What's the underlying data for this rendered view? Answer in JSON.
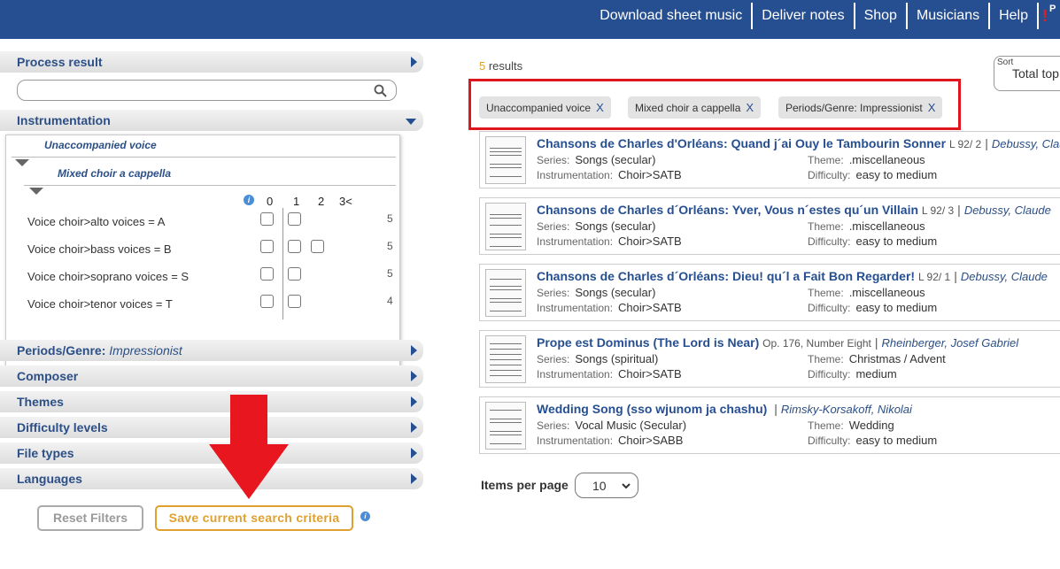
{
  "topnav": {
    "items": [
      "Download sheet music",
      "Deliver notes",
      "Shop",
      "Musicians",
      "Help"
    ],
    "logo_fragment": "P"
  },
  "sidebar": {
    "process_result": "Process result",
    "search_placeholder": "",
    "instrumentation": {
      "label": "Instrumentation",
      "chain": [
        "Unaccompanied voice",
        "Mixed choir a cappella"
      ],
      "column_headers": [
        "0",
        "1",
        "2",
        "3<"
      ],
      "rows": [
        {
          "label": "Voice choir>alto voices = A",
          "count": "5"
        },
        {
          "label": "Voice choir>bass voices = B",
          "count": "5"
        },
        {
          "label": "Voice choir>soprano voices = S",
          "count": "5"
        },
        {
          "label": "Voice choir>tenor voices = T",
          "count": "4"
        }
      ]
    },
    "periods_label": "Periods/Genre:",
    "periods_value": "Impressionist",
    "sections": [
      "Composer",
      "Themes",
      "Difficulty levels",
      "File types",
      "Languages"
    ],
    "reset_label": "Reset Filters",
    "save_label": "Save current search criteria"
  },
  "results": {
    "count": "5",
    "count_suffix": " results",
    "sort_label": "Sort",
    "sort_value": "Total top",
    "active_filters": [
      "Unaccompanied voice",
      "Mixed choir a cappella",
      "Periods/Genre: Impressionist"
    ],
    "filter_remove": "X",
    "labels": {
      "series": "Series:",
      "instrumentation": "Instrumentation:",
      "theme": "Theme:",
      "difficulty": "Difficulty:"
    },
    "items": [
      {
        "title": "Chansons de Charles d'Orléans: Quand j´ai Ouy le Tambourin Sonner",
        "opus": "L 92/ 2",
        "composer": "Debussy, Claude",
        "series": "Songs (secular)",
        "instrumentation": "Choir>SATB",
        "theme": ".miscellaneous",
        "difficulty": "easy to medium"
      },
      {
        "title": "Chansons de Charles d´Orléans: Yver, Vous n´estes qu´un Villain",
        "opus": "L 92/ 3",
        "composer": "Debussy, Claude",
        "series": "Songs (secular)",
        "instrumentation": "Choir>SATB",
        "theme": ".miscellaneous",
        "difficulty": "easy to medium"
      },
      {
        "title": "Chansons de Charles d´Orléans: Dieu! qu´l a Fait Bon Regarder!",
        "opus": "L 92/ 1",
        "composer": "Debussy, Claude",
        "series": "Songs (secular)",
        "instrumentation": "Choir>SATB",
        "theme": ".miscellaneous",
        "difficulty": "easy to medium"
      },
      {
        "title": "Prope est Dominus (The Lord is Near)",
        "opus": "Op. 176, Number Eight",
        "composer": "Rheinberger, Josef Gabriel",
        "series": "Songs (spiritual)",
        "instrumentation": "Choir>SATB",
        "theme": "Christmas / Advent",
        "difficulty": "medium"
      },
      {
        "title": "Wedding Song (sso wjunom ja chashu)",
        "opus": "",
        "composer": "Rimsky-Korsakoff, Nikolai",
        "series": "Vocal Music (Secular)",
        "instrumentation": "Choir>SABB",
        "theme": "Wedding",
        "difficulty": "easy to medium"
      }
    ],
    "items_per_page_label": "Items per page",
    "items_per_page_value": "10"
  },
  "colors": {
    "topbar": "#264f91",
    "accent_orange": "#e0a030",
    "highlight_red": "#e0161f",
    "link_blue": "#264f91"
  }
}
